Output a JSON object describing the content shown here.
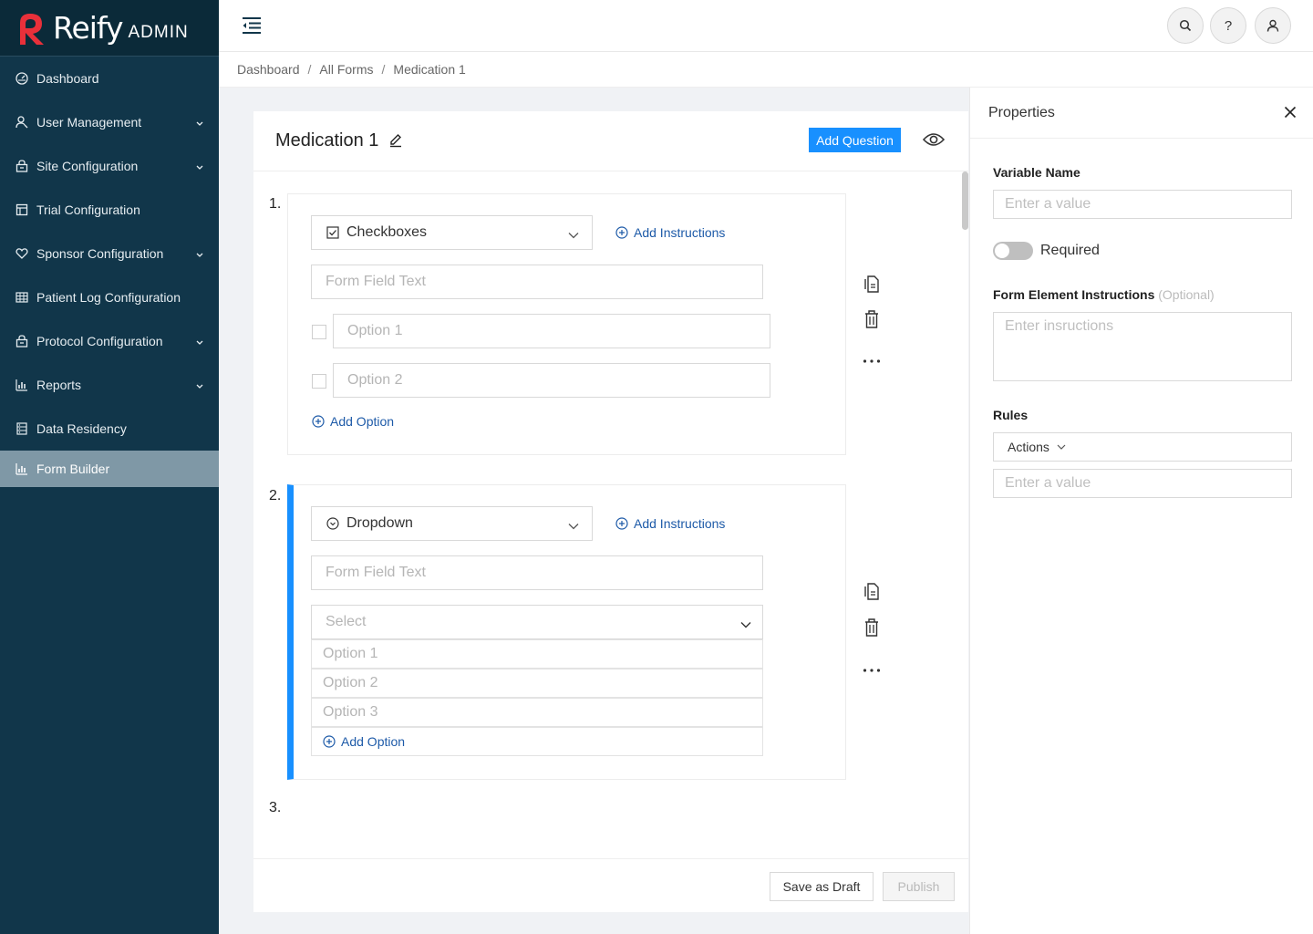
{
  "brand": {
    "name": "Reify",
    "suffix": "ADMIN",
    "accent": "#e8303a"
  },
  "sidebar": {
    "items": [
      {
        "label": "Dashboard",
        "icon": "dashboard-icon",
        "has_caret": false
      },
      {
        "label": "User Management",
        "icon": "user-icon",
        "has_caret": true
      },
      {
        "label": "Site Configuration",
        "icon": "lock-icon",
        "has_caret": true
      },
      {
        "label": "Trial Configuration",
        "icon": "layout-icon",
        "has_caret": false
      },
      {
        "label": "Sponsor Configuration",
        "icon": "heart-icon",
        "has_caret": true
      },
      {
        "label": "Patient Log Configuration",
        "icon": "table-icon",
        "has_caret": false
      },
      {
        "label": "Protocol Configuration",
        "icon": "lock-icon",
        "has_caret": true
      },
      {
        "label": "Reports",
        "icon": "bar-chart-icon",
        "has_caret": true
      },
      {
        "label": "Data Residency",
        "icon": "database-icon",
        "has_caret": false
      },
      {
        "label": "Form Builder",
        "icon": "bar-chart-icon",
        "has_caret": false,
        "active": true
      }
    ]
  },
  "breadcrumb": {
    "items": [
      "Dashboard",
      "All Forms",
      "Medication 1"
    ],
    "separator": "/"
  },
  "form": {
    "title": "Medication 1",
    "add_question_label": "Add Question",
    "questions": [
      {
        "number": "1.",
        "type": "Checkboxes",
        "add_instructions": "Add Instructions",
        "field_placeholder": "Form Field Text",
        "options": [
          "Option 1",
          "Option 2"
        ],
        "add_option": "Add Option"
      },
      {
        "number": "2.",
        "type": "Dropdown",
        "add_instructions": "Add Instructions",
        "field_placeholder": "Form Field Text",
        "select_placeholder": "Select",
        "options": [
          "Option 1",
          "Option 2",
          "Option 3"
        ],
        "add_option": "Add Option"
      },
      {
        "number": "3."
      }
    ],
    "save_draft_label": "Save as Draft",
    "publish_label": "Publish"
  },
  "properties": {
    "title": "Properties",
    "variable_name_label": "Variable Name",
    "variable_name_placeholder": "Enter a value",
    "required_label": "Required",
    "required_on": false,
    "instructions_label": "Form Element Instructions",
    "instructions_optional": "(Optional)",
    "instructions_placeholder": "Enter insructions",
    "rules_label": "Rules",
    "actions_label": "Actions",
    "rule_value_placeholder": "Enter a value"
  },
  "colors": {
    "primary": "#1890ff",
    "sidebar_bg": "#11364a",
    "link": "#1d5aa8"
  }
}
